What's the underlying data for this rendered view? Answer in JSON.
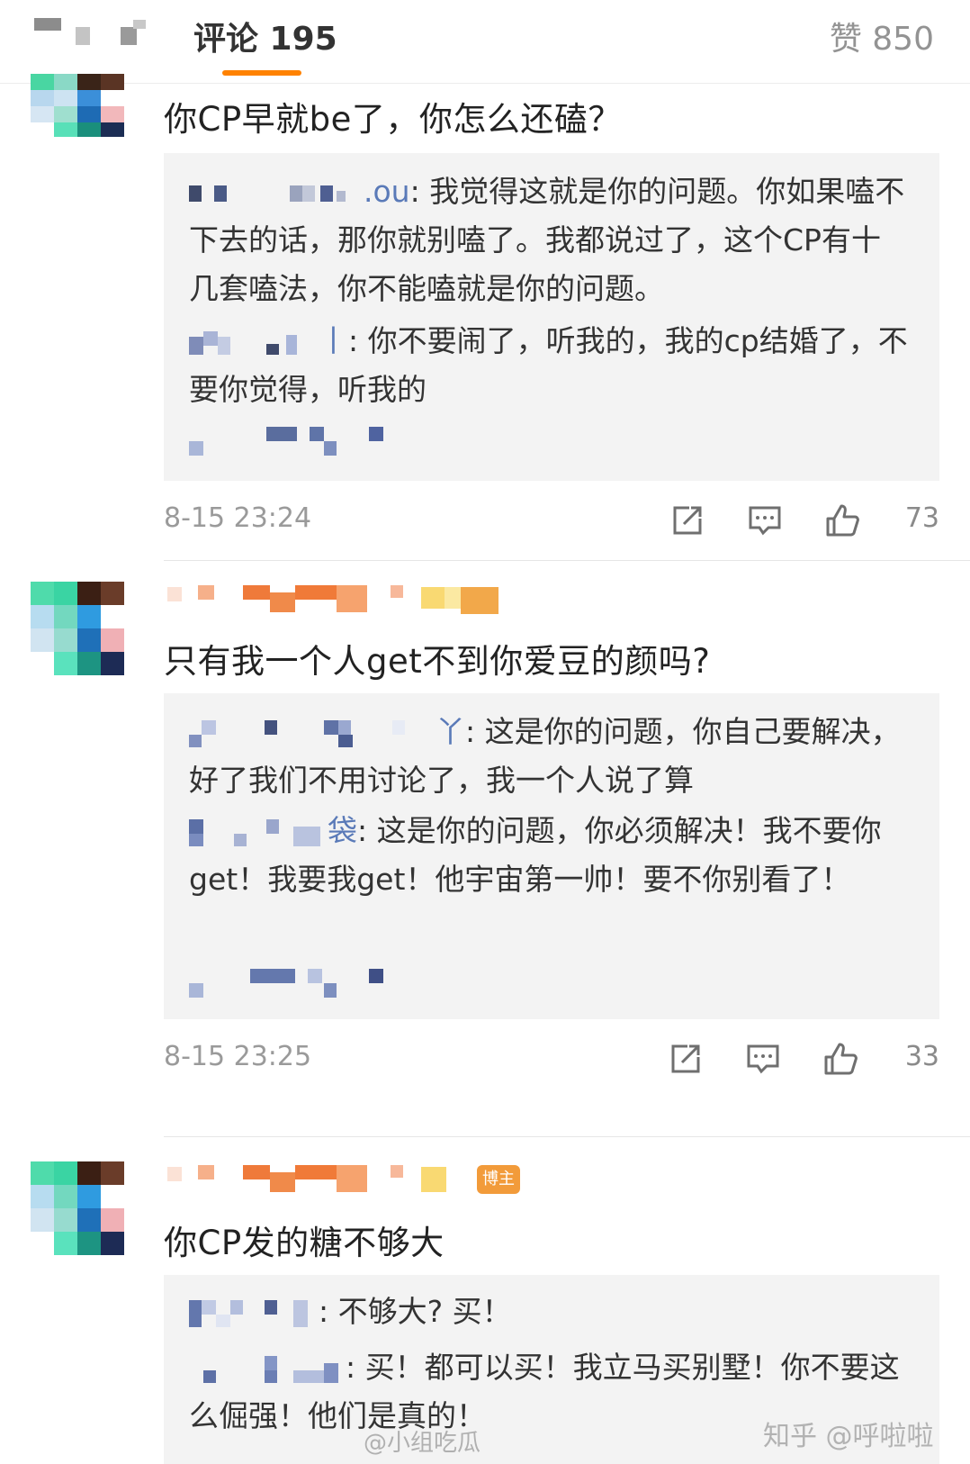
{
  "header": {
    "comments_tab": "评论 195",
    "likes_tab": "赞 850",
    "accent_color": "#ff8200"
  },
  "comments": [
    {
      "text": "你CP早就be了，你怎么还磕？",
      "replies": [
        {
          "name_suffix": ".ou",
          "text": ": 我觉得这就是你的问题。你如果嗑不下去的话，那你就别嗑了。我都说过了，这个CP有十几套嗑法，你不能嗑就是你的问题。"
        },
        {
          "name_suffix": "丨",
          "text": ": 你不要闹了，听我的，我的cp结婚了，不要你觉得，听我的"
        }
      ],
      "time": "8-15 23:24",
      "likes": "73"
    },
    {
      "text": "只有我一个人get不到你爱豆的颜吗?",
      "replies": [
        {
          "name_suffix": "丫",
          "text": ": 这是你的问题，你自己要解决，好了我们不用讨论了，我一个人说了算"
        },
        {
          "name_suffix": "袋",
          "text": ": 这是你的问题，你必须解决！我不要你get！我要我get！他宇宙第一帅！要不你别看了！"
        }
      ],
      "time": "8-15 23:25",
      "likes": "33"
    },
    {
      "badge": "博主",
      "text": "你CP发的糖不够大",
      "replies": [
        {
          "name_suffix": "",
          "text": ": 不够大? 买！"
        },
        {
          "name_suffix": "",
          "text": ": 买！都可以买！我立马买别墅！你不要这么倔强！他们是真的！"
        }
      ]
    }
  ],
  "watermarks": {
    "zhihu": "知乎 @呼啦啦",
    "weibo": "@小组吃瓜"
  }
}
